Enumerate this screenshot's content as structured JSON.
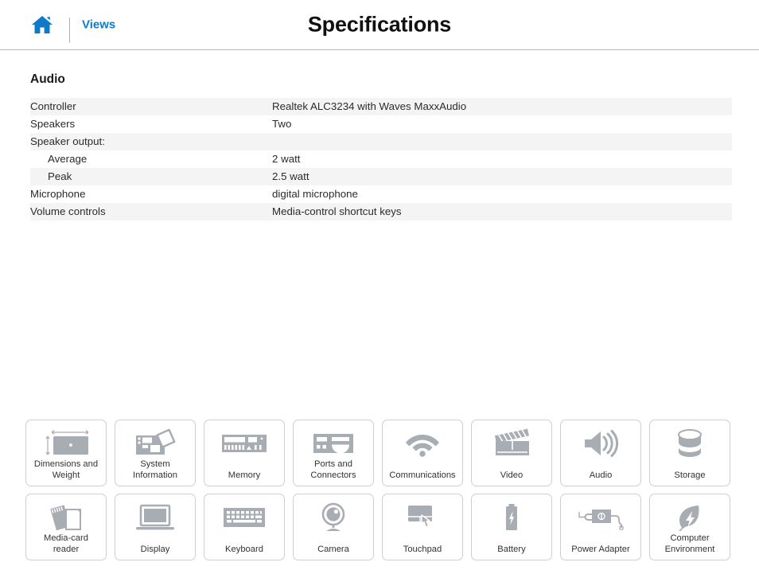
{
  "header": {
    "home_icon": "home-icon",
    "views_label": "Views",
    "title": "Specifications",
    "accent_color": "#0f7ac7"
  },
  "section": {
    "heading": "Audio",
    "rows": [
      {
        "label": "Controller",
        "value": "Realtek ALC3234 with Waves MaxxAudio",
        "indented": false,
        "banded": true
      },
      {
        "label": "Speakers",
        "value": "Two",
        "indented": false,
        "banded": false
      },
      {
        "label": "Speaker output:",
        "value": "",
        "indented": false,
        "banded": true
      },
      {
        "label": "Average",
        "value": "2 watt",
        "indented": true,
        "banded": false
      },
      {
        "label": "Peak",
        "value": "2.5 watt",
        "indented": true,
        "banded": true
      },
      {
        "label": "Microphone",
        "value": "digital microphone",
        "indented": false,
        "banded": false
      },
      {
        "label": "Volume controls",
        "value": "Media-control shortcut keys",
        "indented": false,
        "banded": true
      }
    ]
  },
  "tiles": [
    {
      "label": "Dimensions and\nWeight",
      "icon": "laptop-dimensions-icon"
    },
    {
      "label": "System\nInformation",
      "icon": "motherboard-icon"
    },
    {
      "label": "Memory",
      "icon": "ram-module-icon"
    },
    {
      "label": "Ports and\nConnectors",
      "icon": "ports-panel-icon"
    },
    {
      "label": "Communications",
      "icon": "wifi-icon"
    },
    {
      "label": "Video",
      "icon": "clapperboard-icon"
    },
    {
      "label": "Audio",
      "icon": "speaker-icon"
    },
    {
      "label": "Storage",
      "icon": "disk-cylinder-icon"
    },
    {
      "label": "Media-card\nreader",
      "icon": "memory-card-icon"
    },
    {
      "label": "Display",
      "icon": "monitor-icon"
    },
    {
      "label": "Keyboard",
      "icon": "keyboard-icon"
    },
    {
      "label": "Camera",
      "icon": "webcam-icon"
    },
    {
      "label": "Touchpad",
      "icon": "touchpad-hand-icon"
    },
    {
      "label": "Battery",
      "icon": "battery-bolt-icon"
    },
    {
      "label": "Power Adapter",
      "icon": "power-adapter-icon"
    },
    {
      "label": "Computer\nEnvironment",
      "icon": "eco-leaf-bolt-icon"
    }
  ],
  "colors": {
    "icon_gray": "#a8adb3",
    "band_gray": "#f4f4f4",
    "border_gray": "#cfcfcf"
  }
}
